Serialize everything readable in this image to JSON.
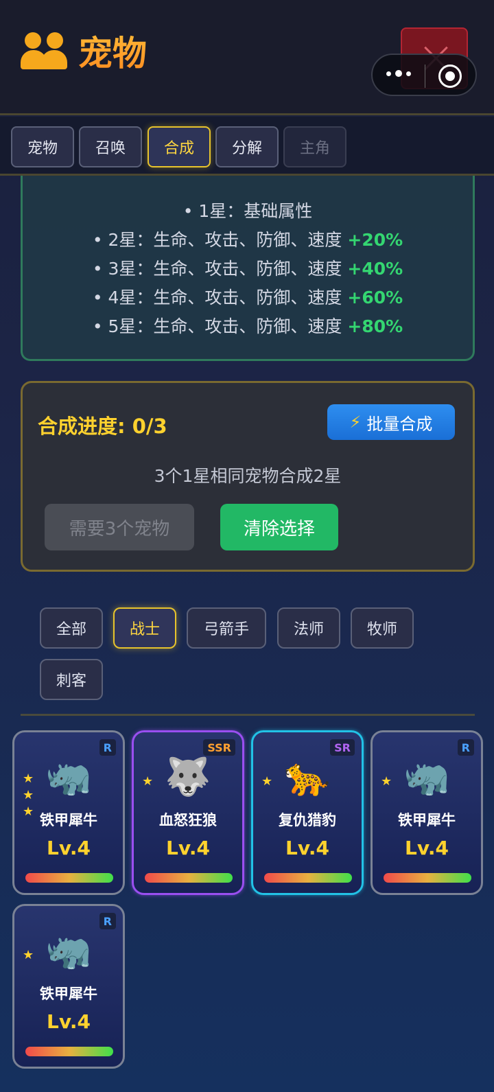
{
  "header": {
    "title": "宠物",
    "icon": "people-icon"
  },
  "tabs": [
    {
      "label": "宠物",
      "state": "normal"
    },
    {
      "label": "召唤",
      "state": "normal"
    },
    {
      "label": "合成",
      "state": "active"
    },
    {
      "label": "分解",
      "state": "normal"
    },
    {
      "label": "主角",
      "state": "disabled"
    }
  ],
  "info": {
    "lines": [
      {
        "text": "• 1星：基础属性",
        "pct": ""
      },
      {
        "text": "• 2星：生命、攻击、防御、速度 ",
        "pct": "+20%"
      },
      {
        "text": "• 3星：生命、攻击、防御、速度 ",
        "pct": "+40%"
      },
      {
        "text": "• 4星：生命、攻击、防御、速度 ",
        "pct": "+60%"
      },
      {
        "text": "• 5星：生命、攻击、防御、速度 ",
        "pct": "+80%"
      }
    ]
  },
  "synth": {
    "progress_label": "合成进度: 0/3",
    "batch_label": "批量合成",
    "hint": "3个1星相同宠物合成2星",
    "need_label": "需要3个宠物",
    "clear_label": "清除选择"
  },
  "filters": [
    {
      "label": "全部",
      "active": false
    },
    {
      "label": "战士",
      "active": true
    },
    {
      "label": "弓箭手",
      "active": false
    },
    {
      "label": "法师",
      "active": false
    },
    {
      "label": "牧师",
      "active": false
    },
    {
      "label": "刺客",
      "active": false
    }
  ],
  "pets": [
    {
      "name": "铁甲犀牛",
      "level": "Lv.4",
      "rarity": "R",
      "stars": 3,
      "emoji": "🦏",
      "hp_fraction": 1.0
    },
    {
      "name": "血怒狂狼",
      "level": "Lv.4",
      "rarity": "SSR",
      "stars": 1,
      "emoji": "🐺",
      "hp_fraction": 1.0
    },
    {
      "name": "复仇猎豹",
      "level": "Lv.4",
      "rarity": "SR",
      "stars": 1,
      "emoji": "🐆",
      "hp_fraction": 1.0
    },
    {
      "name": "铁甲犀牛",
      "level": "Lv.4",
      "rarity": "R",
      "stars": 1,
      "emoji": "🦏",
      "hp_fraction": 1.0
    },
    {
      "name": "铁甲犀牛",
      "level": "Lv.4",
      "rarity": "R",
      "stars": 1,
      "emoji": "🦏",
      "hp_fraction": 1.0
    }
  ],
  "colors": {
    "accent_gold": "#ffd22e",
    "title_orange": "#ff9a24",
    "green": "#22b865",
    "blue": "#1a6fd6",
    "ssr_border": "#9a4ff0",
    "sr_border": "#22c2e6"
  }
}
